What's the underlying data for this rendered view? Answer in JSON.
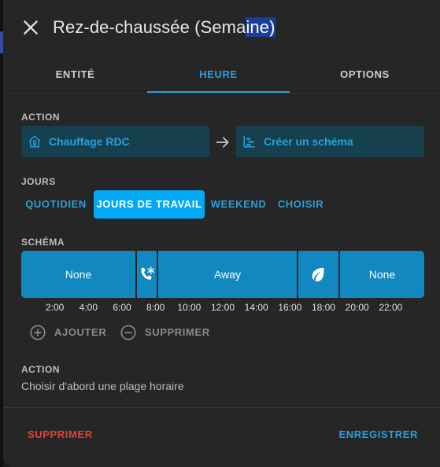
{
  "dialog": {
    "title_main": "Rez-de-chaussée (Sema",
    "title_selected": "ine)"
  },
  "tabs": [
    {
      "label": "ENTITÉ",
      "active": false
    },
    {
      "label": "HEURE",
      "active": true
    },
    {
      "label": "OPTIONS",
      "active": false
    }
  ],
  "action_section": {
    "label": "ACTION",
    "entity": {
      "label": "Chauffage RDC",
      "icon": "home-thermostat-icon"
    },
    "arrow_icon": "arrow-right-icon",
    "scheme": {
      "label": "Créer un schéma",
      "icon": "timeline-icon"
    }
  },
  "days_section": {
    "label": "JOURS",
    "options": [
      {
        "label": "QUOTIDIEN",
        "active": false
      },
      {
        "label": "JOURS DE TRAVAIL",
        "active": true
      },
      {
        "label": "WEEKEND",
        "active": false
      },
      {
        "label": "CHOISIR",
        "active": false
      }
    ]
  },
  "schema_section": {
    "label": "SCHÉMA",
    "blocks": [
      {
        "label": "None",
        "icon": null
      },
      {
        "label": "",
        "icon": "phone-snowflake-icon"
      },
      {
        "label": "Away",
        "icon": null
      },
      {
        "label": "",
        "icon": "leaf-icon"
      },
      {
        "label": "None",
        "icon": null
      }
    ],
    "ticks": [
      "2:00",
      "4:00",
      "6:00",
      "8:00",
      "10:00",
      "12:00",
      "14:00",
      "16:00",
      "18:00",
      "20:00",
      "22:00"
    ]
  },
  "slot_actions": {
    "add_label": "AJOUTER",
    "remove_label": "SUPPRIMER"
  },
  "action_detail": {
    "label": "ACTION",
    "hint": "Choisir d'abord une plage horaire"
  },
  "footer": {
    "delete_label": "SUPPRIMER",
    "save_label": "ENREGISTRER"
  },
  "colors": {
    "accent": "#03a9f4",
    "link": "#2a9fdc",
    "danger": "#db4437",
    "block": "#1188c0"
  }
}
